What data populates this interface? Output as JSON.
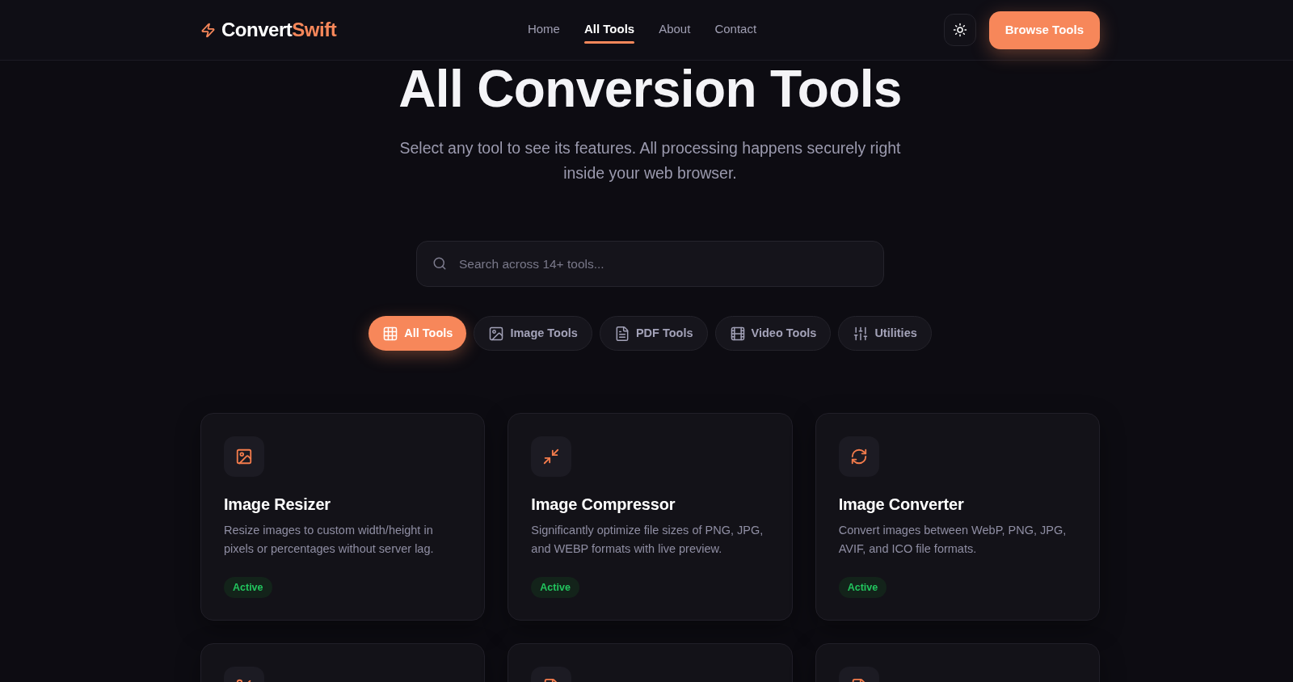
{
  "header": {
    "brand": {
      "text": "Convert",
      "accent": "Swift"
    },
    "nav": [
      {
        "label": "Home",
        "selected": false
      },
      {
        "label": "All Tools",
        "selected": true
      },
      {
        "label": "About",
        "selected": false
      },
      {
        "label": "Contact",
        "selected": false
      }
    ],
    "cta": "Browse Tools"
  },
  "hero": {
    "title": "All Conversion Tools",
    "subtitle": "Select any tool to see its features. All processing happens securely right inside your web browser."
  },
  "search": {
    "placeholder": "Search across 14+ tools..."
  },
  "filters": [
    {
      "label": "All Tools",
      "selected": true
    },
    {
      "label": "Image Tools",
      "selected": false
    },
    {
      "label": "PDF Tools",
      "selected": false
    },
    {
      "label": "Video Tools",
      "selected": false
    },
    {
      "label": "Utilities",
      "selected": false
    }
  ],
  "cards": [
    {
      "kind": "tool",
      "title": "Image Resizer",
      "description": "Resize images to custom width/height in pixels or percentages without server lag.",
      "status": {
        "label": "Active",
        "kind": "active"
      }
    },
    {
      "kind": "tool",
      "title": "Image Compressor",
      "description": "Significantly optimize file sizes of PNG, JPG, and WEBP formats with live preview.",
      "status": {
        "label": "Active",
        "kind": "active"
      }
    },
    {
      "kind": "tool",
      "title": "Image Converter",
      "description": "Convert images between WebP, PNG, JPG, AVIF, and ICO file formats.",
      "status": {
        "label": "Active",
        "kind": "active"
      }
    },
    {
      "kind": "tool"
    },
    {
      "kind": "tool"
    },
    {
      "kind": "tool"
    }
  ]
}
